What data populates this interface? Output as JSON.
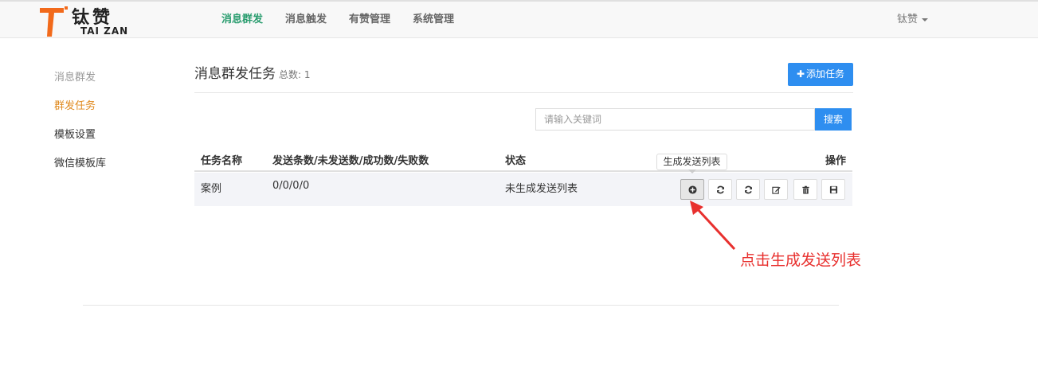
{
  "brand": {
    "name_cn": "钛赞",
    "name_en": "TAI ZAN",
    "logo_letter": "T",
    "accent": "#f26a1b"
  },
  "nav": {
    "items": [
      "消息群发",
      "消息触发",
      "有赞管理",
      "系统管理"
    ],
    "active_color": "#2a9d6f",
    "user": "钛赞"
  },
  "sidebar": {
    "header": "消息群发",
    "items": [
      "群发任务",
      "模板设置",
      "微信模板库"
    ],
    "active_color": "#e08a1e"
  },
  "main": {
    "title": "消息群发任务",
    "count_label": "总数: 1",
    "add_button": "添加任务",
    "search_placeholder": "请输入关键词",
    "search_button": "搜索"
  },
  "table": {
    "headers": [
      "任务名称",
      "发送条数/未发送数/成功数/失败数",
      "状态",
      "操作"
    ],
    "rows": [
      {
        "name": "案例",
        "counts": "0/0/0/0",
        "status": "未生成发送列表"
      }
    ],
    "actions": [
      "plus-circle-icon",
      "refresh-icon",
      "refresh-icon",
      "edit-icon",
      "trash-icon",
      "save-icon"
    ],
    "tooltip": "生成发送列表"
  },
  "annotation": {
    "text": "点击生成发送列表",
    "color": "#e8302e"
  }
}
